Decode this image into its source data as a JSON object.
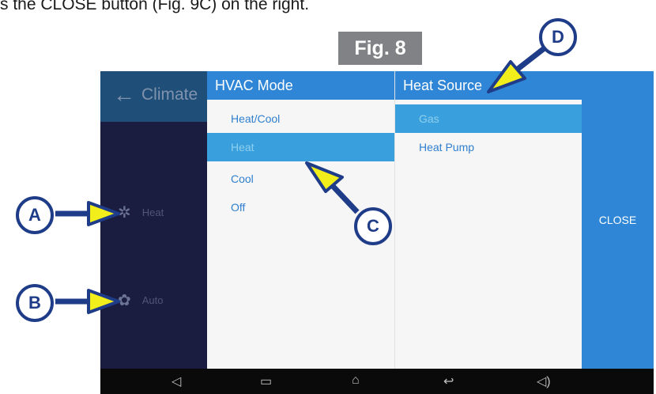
{
  "caption": {
    "text": "s the CLOSE button (Fig. 9C) on the right."
  },
  "figure_label": "Fig. 8",
  "background": {
    "title": "Climate",
    "rows": [
      {
        "label": "Heat"
      },
      {
        "label": "Auto"
      }
    ]
  },
  "hvac_mode": {
    "header": "HVAC Mode",
    "options": [
      "Heat/Cool",
      "Heat",
      "Cool",
      "Off"
    ],
    "selected": "Heat"
  },
  "heat_source": {
    "header": "Heat Source",
    "options": [
      "Gas",
      "Heat Pump"
    ],
    "selected": "Gas"
  },
  "close_label": "CLOSE",
  "callouts": {
    "a": "A",
    "b": "B",
    "c": "C",
    "d": "D"
  },
  "colors": {
    "header_blue": "#2f86d6",
    "selected_blue": "#3aa0dd",
    "callout_navy": "#1f3c88",
    "arrow_yellow": "#f2ee1c"
  },
  "nav_icons": [
    "volume-down-icon",
    "recent-apps-icon",
    "home-icon",
    "back-icon",
    "volume-up-icon"
  ]
}
